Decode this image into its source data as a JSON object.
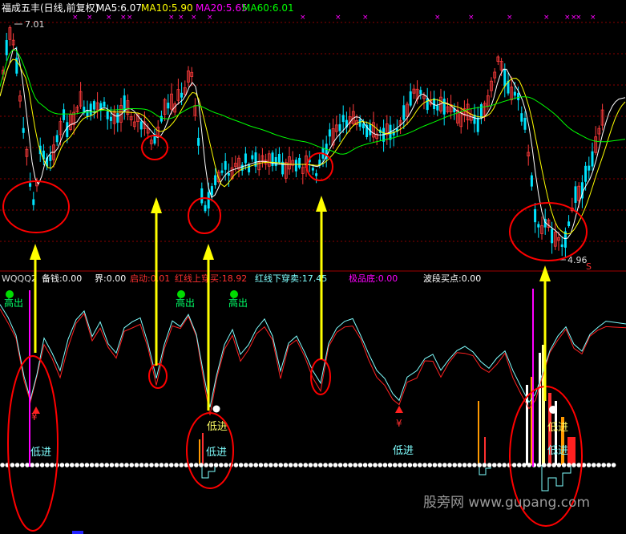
{
  "colors": {
    "background": "#000000",
    "candle_up": "#ff3b3b",
    "candle_down": "#00e5ff",
    "ma5": "#ffffff",
    "ma10": "#ffff00",
    "ma20": "#ff00ff",
    "ma60": "#00ff00",
    "dash_grid": "#8b0000",
    "annotation": "#ff0000",
    "arrow": "#ffff00",
    "indicator_line1": "#ff2020",
    "indicator_line2": "#80ffff"
  },
  "header": {
    "title": "福成五丰(日线,前复权)",
    "ma5": "MA5:6.07",
    "ma10": "MA10:5.90",
    "ma20": "MA20:5.65",
    "ma60": "MA60:6.01"
  },
  "price_panel": {
    "high_label": "7.01",
    "low_label": "4.96",
    "s_marker": "S"
  },
  "indicator_header": {
    "name": "WQQQ2",
    "item1": "备钱:0.00",
    "item2": "界:0.00",
    "item3": "启动:0.01",
    "item4": "红线上穿买:18.92",
    "item5": "红线下穿卖:17.45",
    "item6": "极品底:0.00",
    "item7": "波段买点:0.00"
  },
  "signals": {
    "high_out": "高出",
    "low_in": "低进",
    "yen": "¥"
  },
  "watermark": "股旁网 www.gupang.com",
  "chart_data": [
    {
      "type": "candlestick",
      "title": "福成五丰(日线,前复权)",
      "series": [
        {
          "name": "MA5",
          "last": 6.07
        },
        {
          "name": "MA10",
          "last": 5.9
        },
        {
          "name": "MA20",
          "last": 5.65
        },
        {
          "name": "MA60",
          "last": 6.01
        }
      ],
      "annotations": [
        "7.01",
        "4.96"
      ],
      "ylim": [
        4.8,
        7.1
      ]
    },
    {
      "type": "line",
      "title": "WQQQ2",
      "values": {
        "备钱": 0.0,
        "界": 0.0,
        "启动": 0.01,
        "红线上穿买": 18.92,
        "红线下穿卖": 17.45,
        "极品底": 0.0,
        "波段买点": 0.0
      }
    }
  ]
}
